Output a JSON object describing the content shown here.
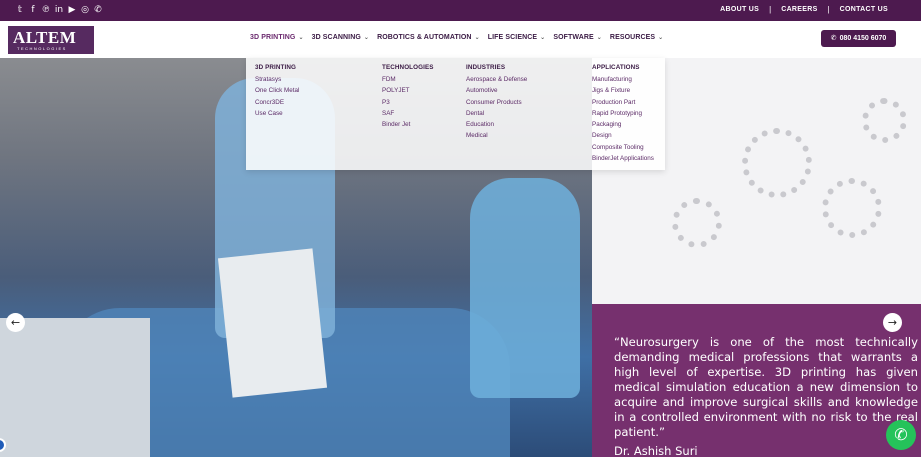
{
  "topbar": {
    "social_icons": [
      "twitter-icon",
      "facebook-icon",
      "pinterest-icon",
      "linkedin-icon",
      "youtube-icon",
      "instagram-icon",
      "whatsapp-icon"
    ],
    "links": [
      "ABOUT US",
      "CAREERS",
      "CONTACT US"
    ],
    "separator": "|"
  },
  "header": {
    "logo_text": "ALTEM",
    "logo_sub": "TECHNOLOGIES",
    "nav": [
      {
        "label": "3D PRINTING",
        "active": true
      },
      {
        "label": "3D SCANNING",
        "active": false
      },
      {
        "label": "ROBOTICS & AUTOMATION",
        "active": false
      },
      {
        "label": "LIFE SCIENCE",
        "active": false
      },
      {
        "label": "SOFTWARE",
        "active": false
      },
      {
        "label": "RESOURCES",
        "active": false
      }
    ],
    "chevron": "⌄",
    "phone": "080 4150 6070"
  },
  "megamenu": {
    "columns": [
      {
        "title": "3D PRINTING",
        "items": [
          "Stratasys",
          "One Click Metal",
          "Concr3DE",
          "Use Case"
        ]
      },
      {
        "title": "TECHNOLOGIES",
        "items": [
          "FDM",
          "POLYJET",
          "P3",
          "SAF",
          "Binder Jet"
        ]
      },
      {
        "title": "INDUSTRIES",
        "items": [
          "Aerospace & Defense",
          "Automotive",
          "Consumer Products",
          "Dental",
          "Education",
          "Medical"
        ]
      },
      {
        "title": "APPLICATIONS",
        "items": [
          "Manufacturing",
          "Jigs & Fixture",
          "Production Part",
          "Rapid Prototyping",
          "Packaging",
          "Design",
          "Composite Tooling",
          "BinderJet Applications"
        ]
      }
    ]
  },
  "hero": {
    "quote": "“Neurosurgery is one of the most technically demanding medical professions that warrants a high level of expertise. 3D printing has given medical simulation education a new dimension to acquire and improve surgical skills and knowledge in a controlled environment with no risk to the real patient.”",
    "author": "Dr. Ashish Suri",
    "colors": {
      "brand": "#4d1a4f",
      "quote_bg": "#76306e",
      "whatsapp": "#25c35a"
    }
  }
}
